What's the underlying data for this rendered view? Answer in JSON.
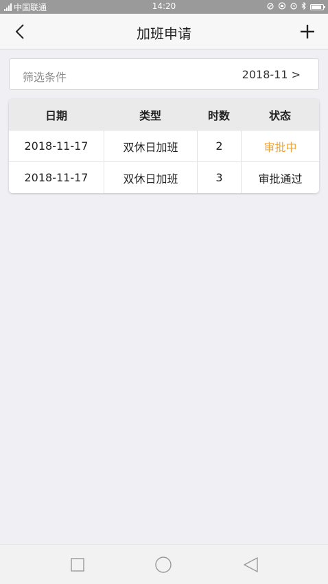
{
  "status_bar": {
    "carrier": "中国联通",
    "time": "14:20"
  },
  "nav": {
    "title": "加班申请",
    "back_icon": "chevron-left-icon",
    "add_icon": "plus-icon"
  },
  "filter": {
    "label": "筛选条件",
    "value": "2018-11 >"
  },
  "table": {
    "headers": [
      "日期",
      "类型",
      "时数",
      "状态"
    ],
    "rows": [
      {
        "date": "2018-11-17",
        "type": "双休日加班",
        "hours": "2",
        "status": "审批中",
        "status_color": "#f0a63a"
      },
      {
        "date": "2018-11-17",
        "type": "双休日加班",
        "hours": "3",
        "status": "审批通过",
        "status_color": "#222222"
      }
    ]
  },
  "system_nav": {
    "recent_icon": "square-icon",
    "home_icon": "circle-icon",
    "back_icon": "triangle-back-icon"
  }
}
